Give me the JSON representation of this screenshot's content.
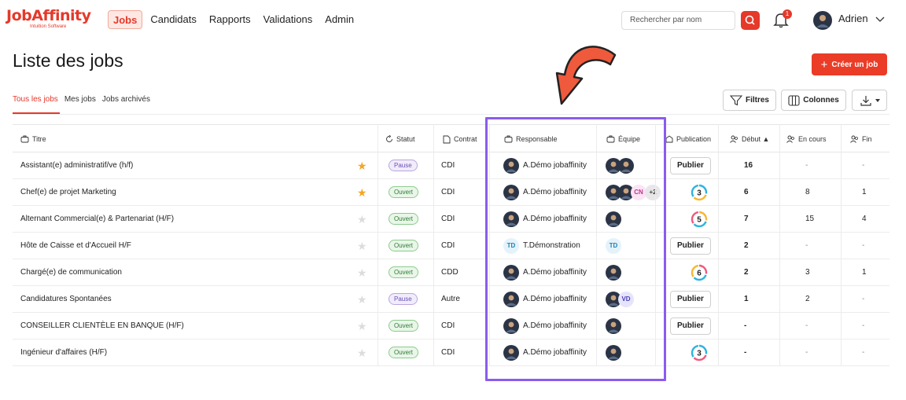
{
  "app": {
    "brand": "JobAffinity",
    "brand_sub": "Intuition Software",
    "nav": [
      "Jobs",
      "Candidats",
      "Rapports",
      "Validations",
      "Admin"
    ],
    "search_placeholder": "Rechercher par nom",
    "notif_count": "1",
    "user": "Adrien"
  },
  "page": {
    "title": "Liste des jobs",
    "create_label": "Créer un job",
    "tabs": [
      "Tous les jobs",
      "Mes jobs",
      "Jobs archivés"
    ],
    "filters_label": "Filtres",
    "columns_label": "Colonnes"
  },
  "table": {
    "headers": {
      "titre": "Titre",
      "statut": "Statut",
      "contrat": "Contrat",
      "responsable": "Responsable",
      "equipe": "Équipe",
      "publication": "Publication",
      "debut": "Début ▲",
      "encours": "En cours",
      "fin": "Fin"
    },
    "rows": [
      {
        "title": "Assistant(e) administratif/ve (h/f)",
        "fav": true,
        "status": "Pause",
        "contract": "CDI",
        "owner": "A.Démo jobaffinity",
        "owner_initials": "",
        "team_initials": [],
        "team_extra": "",
        "publication": "Publier",
        "pub_count": "",
        "debut": "16",
        "encours": "-",
        "fin": "-"
      },
      {
        "title": "Chef(e) de projet Marketing",
        "fav": true,
        "status": "Ouvert",
        "contract": "CDI",
        "owner": "A.Démo jobaffinity",
        "owner_initials": "",
        "team_initials": [
          "CN"
        ],
        "team_extra": "+2",
        "publication": "",
        "pub_count": "3",
        "debut": "6",
        "encours": "8",
        "fin": "1"
      },
      {
        "title": "Alternant Commercial(e) & Partenariat (H/F)",
        "fav": false,
        "status": "Ouvert",
        "contract": "CDI",
        "owner": "A.Démo jobaffinity",
        "owner_initials": "",
        "team_initials": [],
        "team_extra": "",
        "publication": "",
        "pub_count": "5",
        "debut": "7",
        "encours": "15",
        "fin": "4"
      },
      {
        "title": "Hôte de Caisse  et d'Accueil H/F",
        "fav": false,
        "status": "Ouvert",
        "contract": "CDI",
        "owner": "T.Démonstration",
        "owner_initials": "TD",
        "team_initials": [
          "TD"
        ],
        "team_extra": "",
        "publication": "Publier",
        "pub_count": "",
        "debut": "2",
        "encours": "-",
        "fin": "-"
      },
      {
        "title": "Chargé(e) de  communication",
        "fav": false,
        "status": "Ouvert",
        "contract": "CDD",
        "owner": "A.Démo jobaffinity",
        "owner_initials": "",
        "team_initials": [],
        "team_extra": "",
        "publication": "",
        "pub_count": "6",
        "debut": "2",
        "encours": "3",
        "fin": "1"
      },
      {
        "title": "Candidatures Spontanées",
        "fav": false,
        "status": "Pause",
        "contract": "Autre",
        "owner": "A.Démo jobaffinity",
        "owner_initials": "",
        "team_initials": [
          "VD"
        ],
        "team_extra": "",
        "publication": "Publier",
        "pub_count": "",
        "debut": "1",
        "encours": "2",
        "fin": "-"
      },
      {
        "title": "CONSEILLER CLIENTÈLE EN BANQUE (H/F)",
        "fav": false,
        "status": "Ouvert",
        "contract": "CDI",
        "owner": "A.Démo jobaffinity",
        "owner_initials": "",
        "team_initials": [],
        "team_extra": "",
        "publication": "Publier",
        "pub_count": "",
        "debut": "-",
        "encours": "-",
        "fin": "-"
      },
      {
        "title": "Ingénieur d'affaires (H/F)",
        "fav": false,
        "status": "Ouvert",
        "contract": "CDI",
        "owner": "A.Démo jobaffinity",
        "owner_initials": "",
        "team_initials": [],
        "team_extra": "",
        "publication": "",
        "pub_count": "3",
        "debut": "-",
        "encours": "-",
        "fin": "-"
      }
    ]
  },
  "colors": {
    "brand": "#e5392a",
    "highlight": "#8a5cf0",
    "arrow": "#ef5a3c"
  }
}
